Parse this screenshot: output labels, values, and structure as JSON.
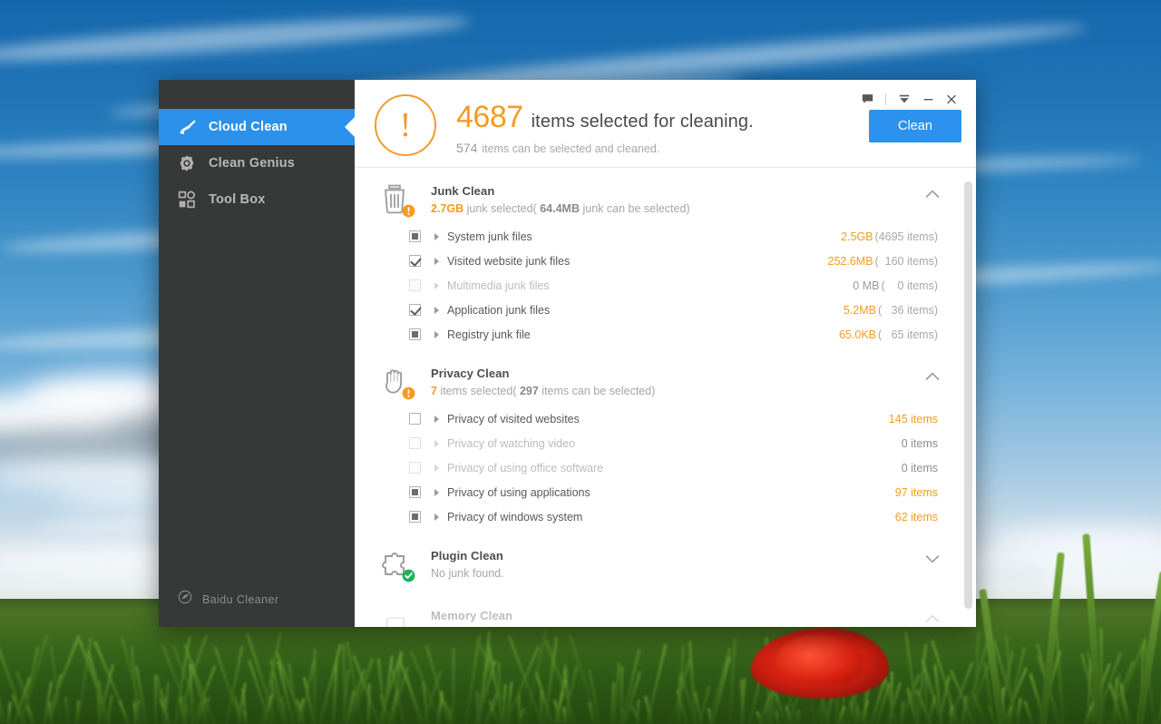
{
  "sidebar": {
    "items": [
      {
        "label": "Cloud Clean",
        "icon": "broom-icon",
        "active": true
      },
      {
        "label": "Clean Genius",
        "icon": "gear-icon",
        "active": false
      },
      {
        "label": "Tool Box",
        "icon": "grid-icon",
        "active": false
      }
    ],
    "brand": {
      "label": "Baidu Cleaner",
      "icon": "baidu-paw-icon"
    }
  },
  "titlebar": {
    "buttons": [
      {
        "name": "feedback-icon",
        "glyph": "speech-bubble"
      },
      {
        "name": "menu-icon",
        "glyph": "caret-menu"
      },
      {
        "name": "minimize-icon",
        "glyph": "minimize"
      },
      {
        "name": "close-icon",
        "glyph": "close"
      }
    ]
  },
  "header": {
    "status_icon": "warning-exclamation-icon",
    "count": "4687",
    "headline": "items selected for cleaning.",
    "sub_count": "574",
    "sub_text": "items can be selected and cleaned.",
    "clean_button": "Clean"
  },
  "colors": {
    "accent_blue": "#2b92ef",
    "orange": "#f59b23",
    "sidebar_bg": "#373838",
    "text_dark": "#4d4d4d",
    "text_muted": "#a6a6a6",
    "green_ok": "#27ae60"
  },
  "sections": [
    {
      "id": "junk-clean",
      "title": "Junk Clean",
      "icon": "trash-bin-icon",
      "badge": "warning-badge",
      "expanded": true,
      "chevron": "chevron-up-icon",
      "summary": {
        "highlight": "2.7GB",
        "mid": " junk selected( ",
        "highlight2": "64.4MB",
        "tail": " junk can be selected)"
      },
      "rows": [
        {
          "label": "System junk files",
          "state": "partial",
          "size": "2.5GB",
          "count": "(4695 items)",
          "dim": false
        },
        {
          "label": "Visited website junk files",
          "state": "checked",
          "size": "252.6MB",
          "count": "(  160 items)",
          "dim": false
        },
        {
          "label": "Multimedia junk files",
          "state": "off",
          "size": "0 MB",
          "count": "(    0 items)",
          "dim": true
        },
        {
          "label": "Application junk files",
          "state": "checked",
          "size": "5.2MB",
          "count": "(   36 items)",
          "dim": false
        },
        {
          "label": "Registry junk file",
          "state": "partial",
          "size": "65.0KB",
          "count": "(   65 items)",
          "dim": false
        }
      ]
    },
    {
      "id": "privacy-clean",
      "title": "Privacy Clean",
      "icon": "hand-palm-icon",
      "badge": "warning-badge",
      "expanded": true,
      "chevron": "chevron-up-icon",
      "summary": {
        "highlight": "7",
        "mid": " items selected( ",
        "highlight2": "297",
        "tail": " items can be selected)"
      },
      "rows": [
        {
          "label": "Privacy of visited websites",
          "state": "empty",
          "size": "145 items",
          "count": "",
          "dim": false
        },
        {
          "label": "Privacy of watching video",
          "state": "off",
          "size": "0 items",
          "count": "",
          "dim": true
        },
        {
          "label": "Privacy of using office software",
          "state": "off",
          "size": "0 items",
          "count": "",
          "dim": true
        },
        {
          "label": "Privacy of using applications",
          "state": "partial",
          "size": "97 items",
          "count": "",
          "dim": false
        },
        {
          "label": "Privacy of windows system",
          "state": "partial",
          "size": "62 items",
          "count": "",
          "dim": false
        }
      ]
    },
    {
      "id": "plugin-clean",
      "title": "Plugin Clean",
      "icon": "puzzle-piece-icon",
      "badge": "success-badge",
      "expanded": false,
      "chevron": "chevron-down-icon",
      "summary_plain": "No junk found.",
      "rows": []
    },
    {
      "id": "memory-clean",
      "title": "Memory Clean",
      "icon": "memory-chip-icon",
      "badge": "none",
      "expanded": true,
      "chevron": "chevron-up-icon",
      "summary_plain": "",
      "rows": []
    }
  ],
  "scrollbar": {
    "name": "vertical-scrollbar",
    "thumb_top_pct": 3,
    "thumb_height_pct": 93
  }
}
